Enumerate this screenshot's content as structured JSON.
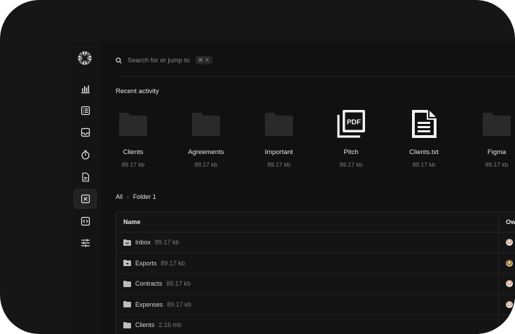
{
  "search": {
    "placeholder": "Search for or jump to",
    "shortcut": "⌘ K"
  },
  "sidebar": {
    "items": [
      {
        "icon": "bar-chart-icon",
        "active": false
      },
      {
        "icon": "list-icon",
        "active": false
      },
      {
        "icon": "inbox-icon",
        "active": false
      },
      {
        "icon": "timer-icon",
        "active": false
      },
      {
        "icon": "document-icon",
        "active": false
      },
      {
        "icon": "close-square-icon",
        "active": true
      },
      {
        "icon": "code-icon",
        "active": false
      },
      {
        "icon": "sliders-icon",
        "active": false
      }
    ]
  },
  "recent": {
    "title": "Recent activity",
    "items": [
      {
        "name": "Clients",
        "size": "89.17 kb",
        "type": "folder"
      },
      {
        "name": "Agreements",
        "size": "89.17 kb",
        "type": "folder"
      },
      {
        "name": "Important",
        "size": "89.17 kb",
        "type": "folder"
      },
      {
        "name": "Pitch",
        "size": "89.17 kb",
        "type": "pdf"
      },
      {
        "name": "Clients.txt",
        "size": "89.17 kb",
        "type": "txt"
      },
      {
        "name": "Figma",
        "size": "89.17 kb",
        "type": "folder"
      }
    ]
  },
  "breadcrumb": {
    "root": "All",
    "current": "Folder 1"
  },
  "table": {
    "columns": {
      "name": "Name",
      "owner": "Ow"
    },
    "rows": [
      {
        "name": "Inbox",
        "size": "89.17 kb",
        "icon": "inbox-folder-icon"
      },
      {
        "name": "Exports",
        "size": "89.17 kb",
        "icon": "export-folder-icon"
      },
      {
        "name": "Contracts",
        "size": "89.17 kb",
        "icon": "folder-icon"
      },
      {
        "name": "Expenses",
        "size": "89.17 kb",
        "icon": "folder-icon"
      },
      {
        "name": "Clients",
        "size": "2.16 mb",
        "icon": "folder-icon"
      }
    ]
  },
  "colors": {
    "background": "#111111",
    "rail": "#141414",
    "text": "#e8e8e8",
    "muted": "#7f7f7f"
  }
}
